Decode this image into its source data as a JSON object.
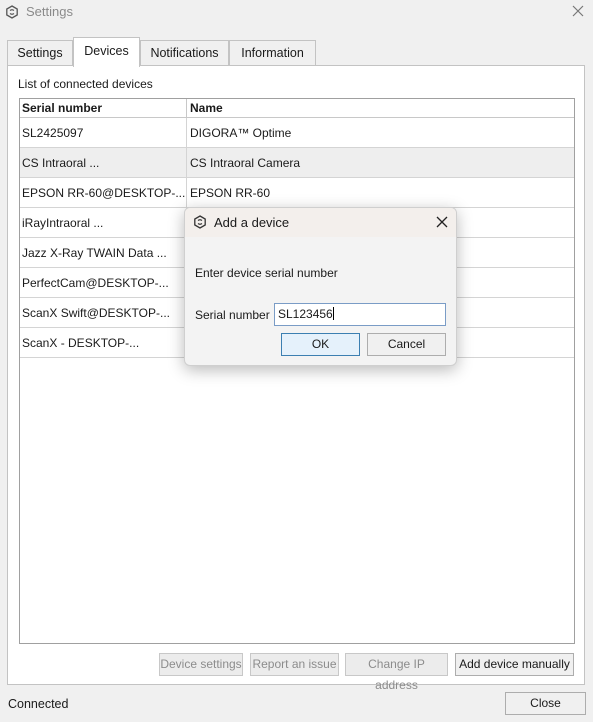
{
  "window": {
    "title": "Settings",
    "icon": "app-logo-icon",
    "close_icon": "close-icon"
  },
  "tabs": [
    {
      "label": "Settings",
      "active": false
    },
    {
      "label": "Devices",
      "active": true
    },
    {
      "label": "Notifications",
      "active": false
    },
    {
      "label": "Information",
      "active": false
    }
  ],
  "devices": {
    "list_label": "List of connected devices",
    "columns": [
      "Serial number",
      "Name"
    ],
    "rows": [
      {
        "serial": "SL2425097",
        "name": "DIGORA™ Optime",
        "selected": false
      },
      {
        "serial": "CS Intraoral ...",
        "name": "CS Intraoral Camera",
        "selected": true
      },
      {
        "serial": "EPSON RR-60@DESKTOP-...",
        "name": "EPSON RR-60",
        "selected": false
      },
      {
        "serial": "iRayIntraoral ...",
        "name": "",
        "selected": false
      },
      {
        "serial": "Jazz X-Ray TWAIN Data ...",
        "name": "",
        "selected": false
      },
      {
        "serial": "PerfectCam@DESKTOP-...",
        "name": "",
        "selected": false
      },
      {
        "serial": "ScanX Swift@DESKTOP-...",
        "name": "",
        "selected": false
      },
      {
        "serial": "ScanX - DESKTOP-...",
        "name": "",
        "selected": false
      }
    ],
    "buttons": {
      "device_settings": "Device settings",
      "report_issue": "Report an issue",
      "change_ip": "Change IP address",
      "add_manually": "Add device manually"
    }
  },
  "footer": {
    "status": "Connected",
    "close_label": "Close"
  },
  "dialog": {
    "title": "Add a device",
    "message": "Enter device serial number",
    "field_label": "Serial number",
    "field_value": "SL123456",
    "ok_label": "OK",
    "cancel_label": "Cancel"
  },
  "colors": {
    "window_bg": "#f0f0f0",
    "selected_row": "#eeeeee",
    "input_border": "#7a9cc6"
  }
}
